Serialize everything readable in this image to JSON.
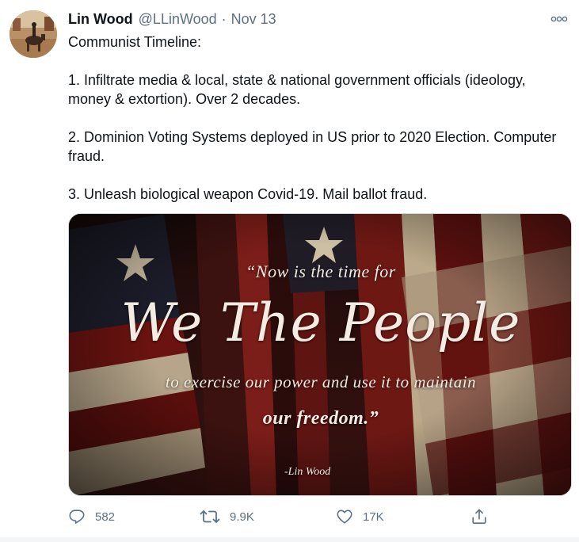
{
  "tweet": {
    "author_name": "Lin Wood",
    "handle": "@LLinWood",
    "separator": "·",
    "date": "Nov 13",
    "text_lines": [
      "Communist Timeline:",
      "",
      "1. Infiltrate media & local, state & national government officials (ideology, money & extortion). Over 2 decades.",
      "",
      "2. Dominion Voting Systems deployed in US prior to 2020 Election. Computer fraud.",
      "",
      "3. Unleash biological weapon Covid-19. Mail ballot fraud."
    ],
    "image_text": {
      "line1": "“Now is the time for",
      "line2": "We The People",
      "line3": "to exercise our power and use it to maintain",
      "line4": "our freedom.”",
      "signature": "-Lin Wood"
    }
  },
  "actions": {
    "reply": {
      "icon": "reply-icon",
      "count": "582"
    },
    "retweet": {
      "icon": "retweet-icon",
      "count": "9.9K"
    },
    "like": {
      "icon": "heart-icon",
      "count": "17K"
    },
    "share": {
      "icon": "share-icon"
    }
  },
  "colors": {
    "text": "#0f1419",
    "secondary": "#5b7083",
    "border": "#cfd9de"
  }
}
